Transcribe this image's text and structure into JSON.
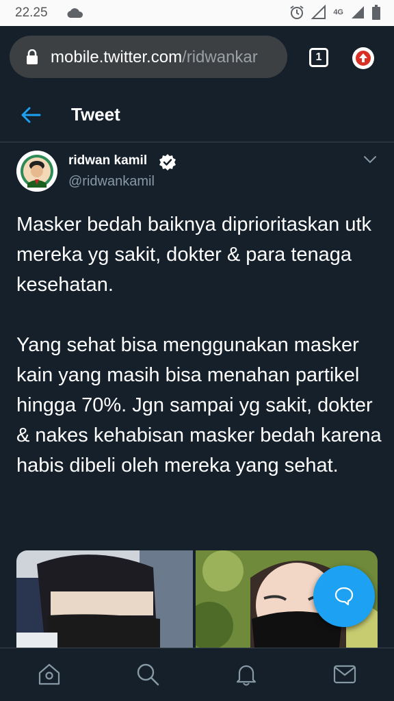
{
  "status_bar": {
    "time": "22.25",
    "network": "4G"
  },
  "browser": {
    "url_host": "mobile.twitter.com",
    "url_path": "/ridwankar",
    "tab_count": "1"
  },
  "header": {
    "title": "Tweet"
  },
  "tweet": {
    "author_name": "ridwan kamil",
    "author_handle": "@ridwankamil",
    "paragraphs": [
      "Masker bedah baiknya diprioritaskan utk mereka yg sakit, dokter & para tenaga kesehatan.",
      "Yang sehat bisa menggunakan masker kain yang masih bisa menahan partikel hingga 70%. Jgn sampai yg sakit, dokter & nakes kehabisan masker bedah karena habis dibeli oleh mereka yang sehat."
    ]
  },
  "icons": {
    "status": [
      "cloud-icon",
      "alarm-icon",
      "signal-empty-icon",
      "signal-icon",
      "battery-icon"
    ],
    "nav": [
      "home-icon",
      "search-icon",
      "notifications-icon",
      "messages-icon"
    ],
    "fab": "compose-icon"
  },
  "colors": {
    "background": "#15202b",
    "accent": "#1da1f2",
    "secondary_text": "#8899a6",
    "divider": "#38444d"
  }
}
